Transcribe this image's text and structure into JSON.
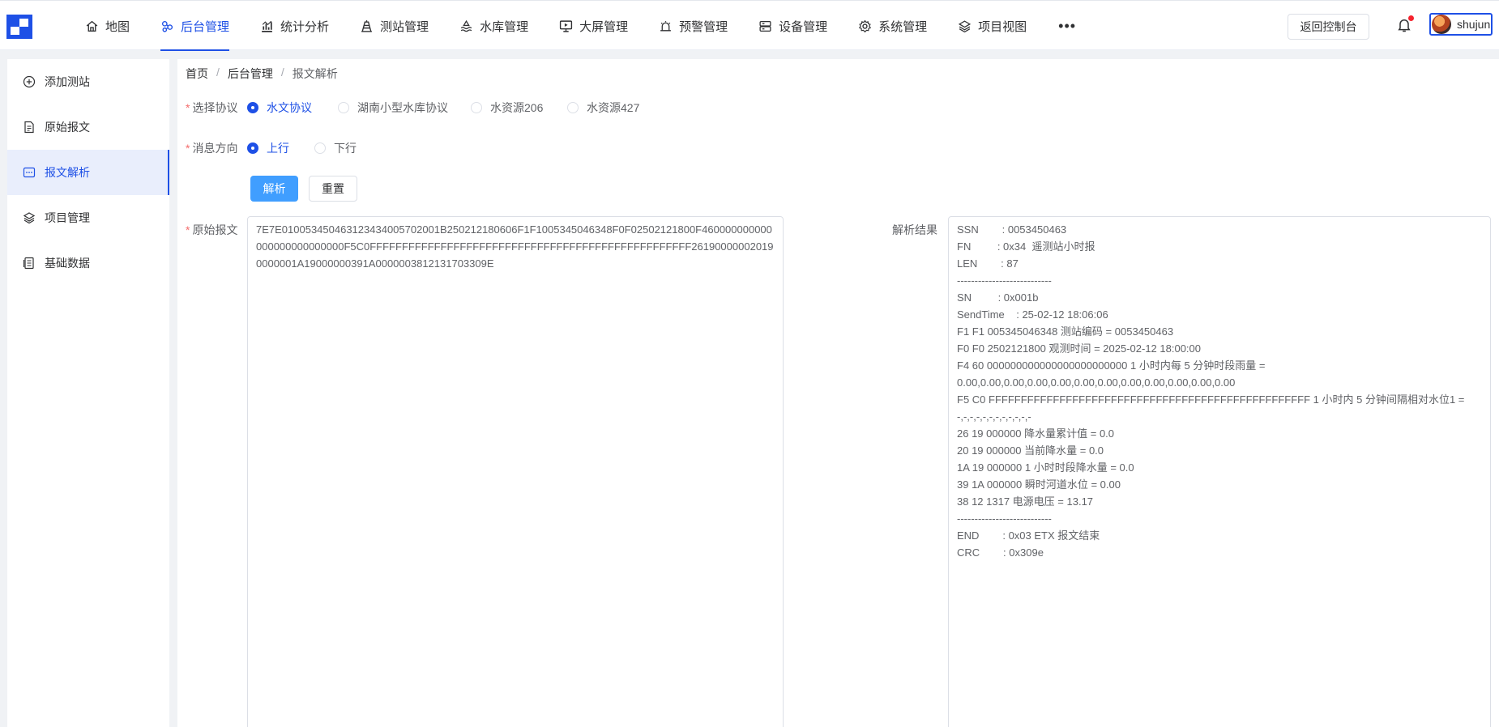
{
  "nav": {
    "items": [
      {
        "label": "地图",
        "icon": "home-icon"
      },
      {
        "label": "后台管理",
        "icon": "cluster-icon"
      },
      {
        "label": "统计分析",
        "icon": "chart-icon"
      },
      {
        "label": "测站管理",
        "icon": "station-icon"
      },
      {
        "label": "水库管理",
        "icon": "reservoir-icon"
      },
      {
        "label": "大屏管理",
        "icon": "monitor-icon"
      },
      {
        "label": "预警管理",
        "icon": "alarm-icon"
      },
      {
        "label": "设备管理",
        "icon": "server-icon"
      },
      {
        "label": "系统管理",
        "icon": "gear-icon"
      },
      {
        "label": "项目视图",
        "icon": "layers-icon"
      }
    ],
    "active_index": 1,
    "more_label": "•••",
    "back_label": "返回控制台",
    "username": "shujun"
  },
  "sidebar": {
    "items": [
      {
        "label": "添加测站",
        "icon": "plus-circle-icon"
      },
      {
        "label": "原始报文",
        "icon": "document-icon"
      },
      {
        "label": "报文解析",
        "icon": "message-icon"
      },
      {
        "label": "项目管理",
        "icon": "layers-icon"
      },
      {
        "label": "基础数据",
        "icon": "data-sheet-icon"
      }
    ],
    "active_index": 2
  },
  "breadcrumb": [
    "首页",
    "后台管理",
    "报文解析"
  ],
  "form": {
    "protocol_label": "选择协议",
    "protocol_options": [
      "水文协议",
      "湖南小型水库协议",
      "水资源206",
      "水资源427"
    ],
    "protocol_selected": 0,
    "direction_label": "消息方向",
    "direction_options": [
      "上行",
      "下行"
    ],
    "direction_selected": 0,
    "parse_button": "解析",
    "reset_button": "重置",
    "raw_label": "原始报文",
    "raw_value": "7E7E01005345046312343400570200 1B250212180606F1F1005345046348F0F02502121800F460000000000000000000000000F5C0FFFFFFFFFFFFFFFFFFFFFFFFFFFFFFFFFFFFFFFFFFFFFFFFFF261900000020190000001A19000000391A0000003812131703309E",
    "result_label": "解析结果",
    "result_lines": [
      "SSN        : 0053450463",
      "FN         : 0x34  遥测站小时报",
      "LEN        : 87",
      "---------------------------",
      "SN         : 0x001b",
      "SendTime    : 25-02-12 18:06:06",
      "F1 F1 005345046348 测站编码 = 0053450463",
      "F0 F0 2502121800 观测时间 = 2025-02-12 18:00:00",
      "F4 60 000000000000000000000000 1 小时内每 5 分钟时段雨量 =",
      "0.00,0.00,0.00,0.00,0.00,0.00,0.00,0.00,0.00,0.00,0.00,0.00",
      "F5 C0 FFFFFFFFFFFFFFFFFFFFFFFFFFFFFFFFFFFFFFFFFFFFFFFFFF 1 小时内 5 分钟间隔相对水位1 =",
      "-,-,-,-,-,-,-,-,-,-,-,-",
      "26 19 000000 降水量累计值 = 0.0",
      "20 19 000000 当前降水量 = 0.0",
      "1A 19 000000 1 小时时段降水量 = 0.0",
      "39 1A 000000 瞬时河道水位 = 0.00",
      "38 12 1317 电源电压 = 13.17",
      "---------------------------",
      "END        : 0x03 ETX 报文结束",
      "CRC        : 0x309e"
    ]
  }
}
